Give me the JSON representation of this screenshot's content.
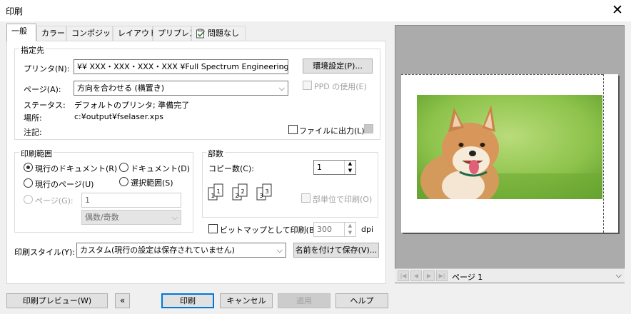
{
  "window": {
    "title": "印刷",
    "close": "✕"
  },
  "tabs": [
    "一般",
    "カラー",
    "コンポジット",
    "レイアウト",
    "プリプレス",
    "問題なし"
  ],
  "destination": {
    "group_title": "指定先",
    "printer_label": "プリンタ(N):",
    "printer_value": "¥¥ XXX・XXX・XXX・XXX ¥Full Spectrum Engineering Driver",
    "env_button": "環境設定(P)...",
    "page_label": "ページ(A):",
    "page_value": "方向を合わせる (横置き)",
    "ppd_label": "PPD の使用(E)",
    "status_label": "ステータス:",
    "status_value": "デフォルトのプリンタ; 準備完了",
    "location_label": "場所:",
    "location_value": "c:¥output¥fselaser.xps",
    "comment_label": "注記:",
    "print_to_file_label": "ファイルに出力(L)"
  },
  "range": {
    "group_title": "印刷範囲",
    "current_document": "現行のドキュメント(R)",
    "documents": "ドキュメント(D)",
    "current_page": "現行のページ(U)",
    "selection": "選択範囲(S)",
    "pages_label": "ページ(G):",
    "pages_value": "1",
    "even_odd": "偶数/奇数"
  },
  "copies": {
    "group_title": "部数",
    "copies_label": "コピー数(C):",
    "copies_value": "1",
    "collate_label": "部単位で印刷(O)",
    "collate_numbers": [
      "1",
      "1",
      "2",
      "2",
      "3",
      "3"
    ]
  },
  "bitmap": {
    "label": "ビットマップとして印刷(B):",
    "value": "300",
    "unit": "dpi"
  },
  "style": {
    "label": "印刷スタイル(Y):",
    "value": "カスタム(現行の設定は保存されていません)",
    "save_as_button": "名前を付けて保存(V)..."
  },
  "buttons": {
    "preview": "印刷プレビュー(W)",
    "collapse": "«",
    "print": "印刷",
    "cancel": "キャンセル",
    "apply": "適用",
    "help": "ヘルプ"
  },
  "preview": {
    "page_label": "ページ 1"
  }
}
